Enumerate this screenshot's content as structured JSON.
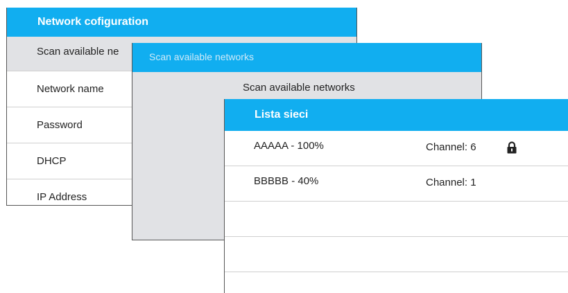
{
  "network_config": {
    "title": "Network cofiguration",
    "rows": [
      {
        "label": "Scan available ne"
      },
      {
        "label": "Network name"
      },
      {
        "label": "Password"
      },
      {
        "label": "DHCP"
      },
      {
        "label": "IP Address"
      }
    ]
  },
  "scan_window": {
    "title": "Scan available networks",
    "label": "Scan available networks"
  },
  "network_list": {
    "title": "Lista sieci",
    "networks": [
      {
        "name": "AAAAA - 100%",
        "channel": "Channel: 6",
        "locked": true,
        "lock_icon": "lock-icon"
      },
      {
        "name": "BBBBB - 40%",
        "channel": "Channel: 1",
        "locked": false
      }
    ]
  },
  "colors": {
    "titlebar": "#11aef0",
    "selected_row": "#e1e2e5",
    "panel_bg": "#e1e2e5"
  }
}
